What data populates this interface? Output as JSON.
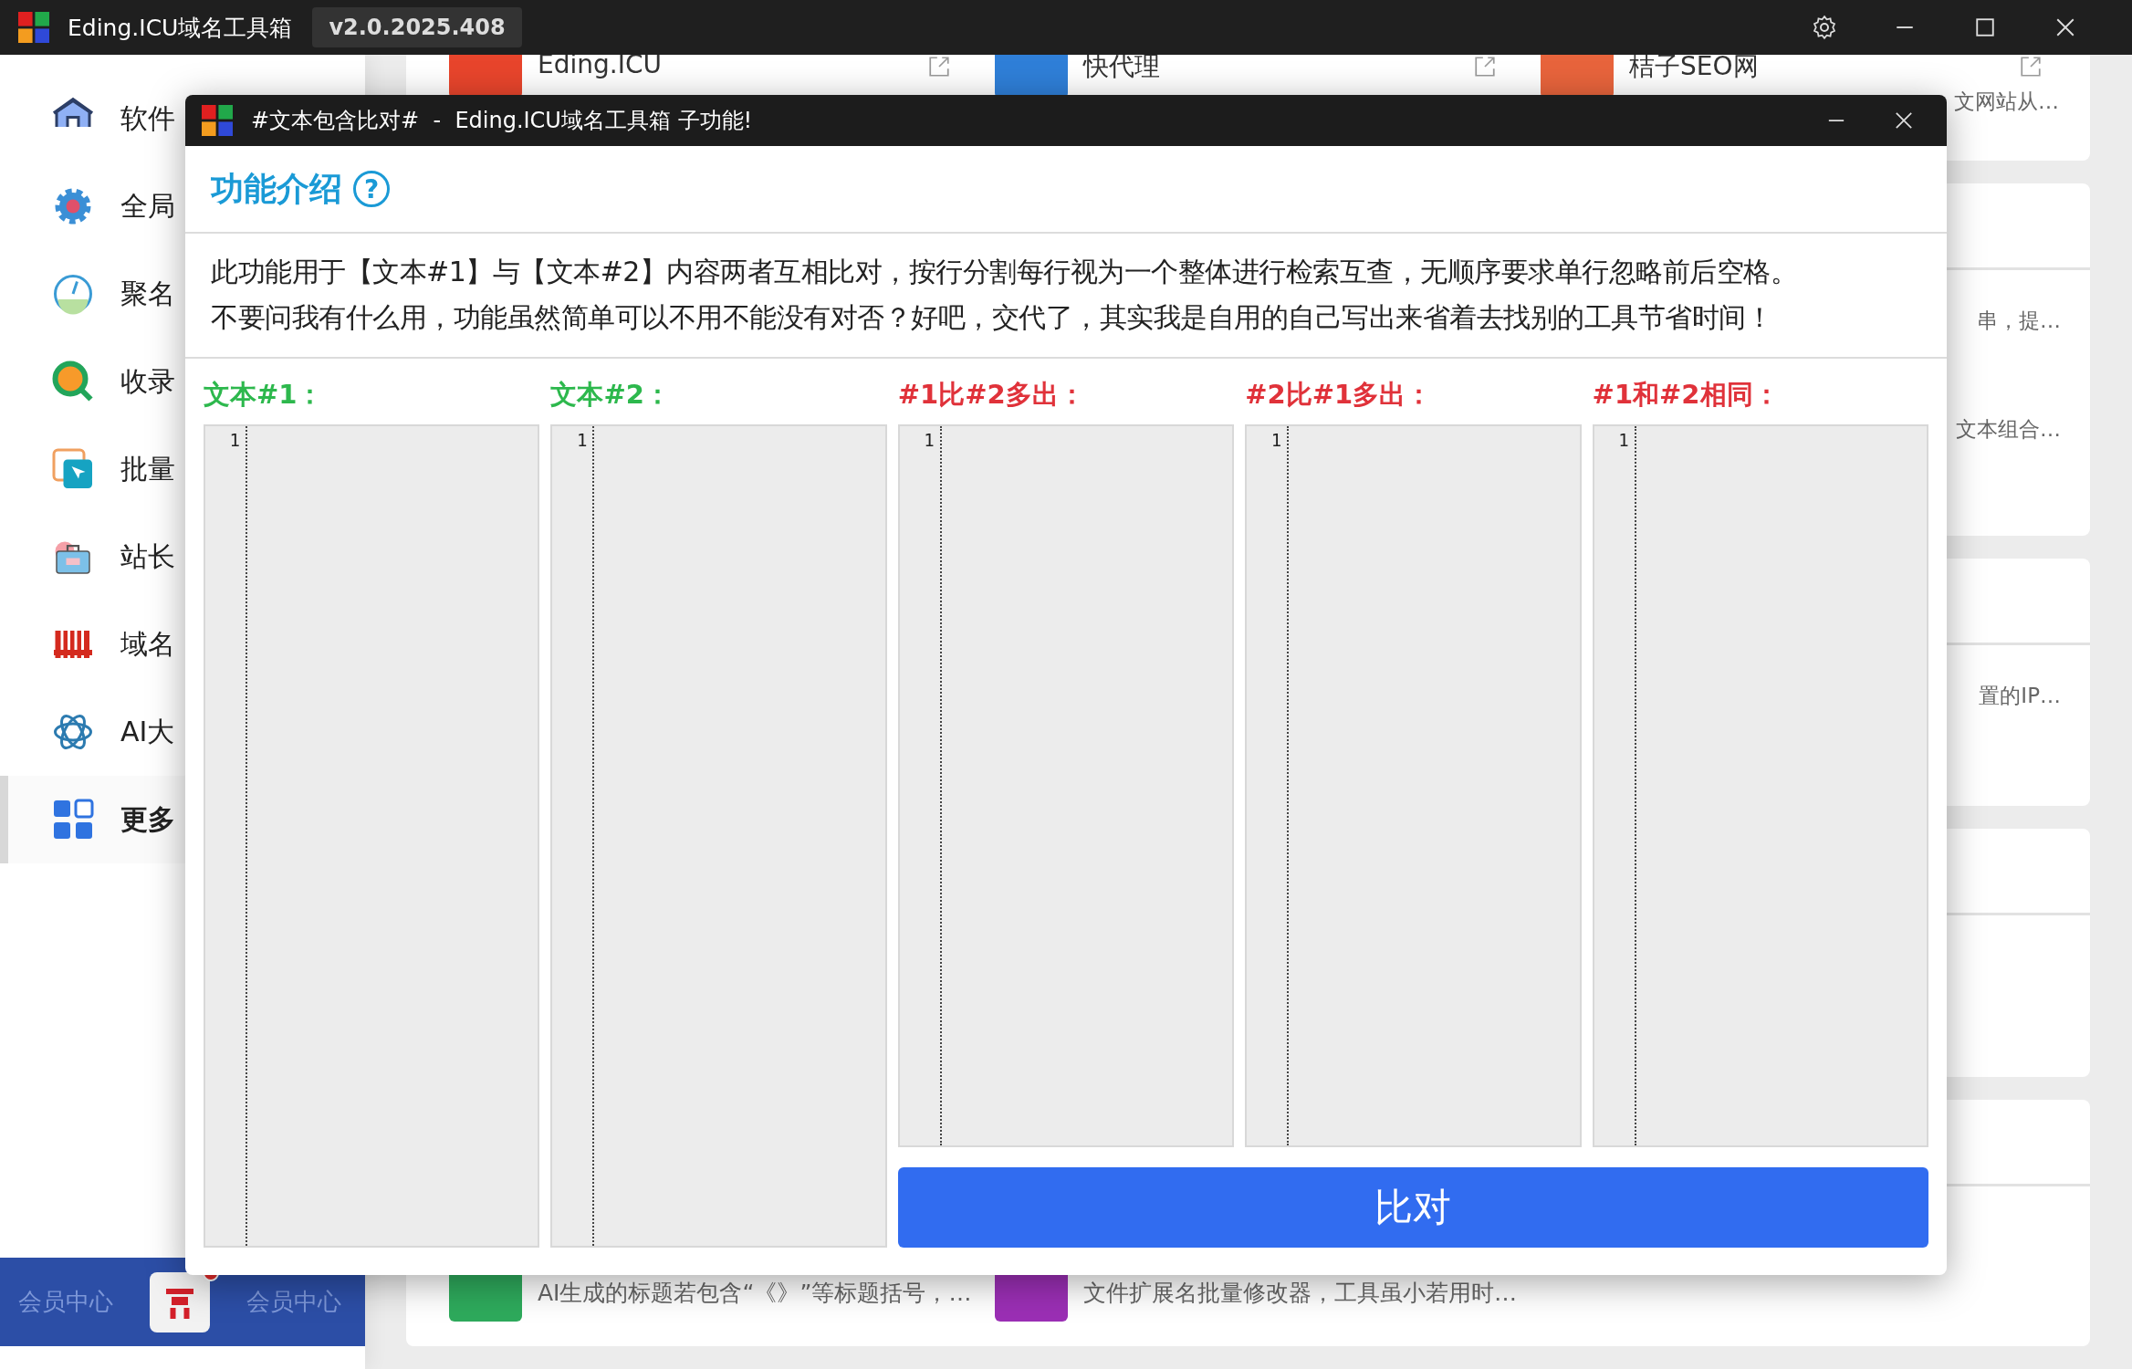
{
  "app": {
    "title": "Eding.ICU域名工具箱",
    "version": "v2.0.2025.408"
  },
  "sidebar": {
    "items": [
      {
        "label": "软件",
        "selected": false
      },
      {
        "label": "全局",
        "selected": false
      },
      {
        "label": "聚名",
        "selected": false
      },
      {
        "label": "收录",
        "selected": false
      },
      {
        "label": "批量",
        "selected": false
      },
      {
        "label": "站长",
        "selected": false
      },
      {
        "label": "域名",
        "selected": false
      },
      {
        "label": "AI大",
        "selected": false
      },
      {
        "label": "更多",
        "selected": true
      }
    ],
    "member_banner": {
      "pattern": [
        "会员中心",
        "会员中心"
      ]
    }
  },
  "content": {
    "cards": [
      {
        "kind": "grid",
        "items": [
          {
            "title": "Eding.ICU",
            "color": "#e8452c"
          },
          {
            "title": "快代理",
            "color": "#2f7fd8"
          },
          {
            "title": "桔子SEO网",
            "color": "#e8643c",
            "description": "文网站从…"
          }
        ]
      },
      {
        "kind": "tail",
        "items": [
          {
            "description": "串，提…"
          },
          {
            "description": "文本组合…"
          }
        ]
      },
      {
        "kind": "tail",
        "items": [
          {
            "description": "置的IP…"
          }
        ]
      },
      {
        "kind": "tail"
      },
      {
        "kind": "grid",
        "items": [
          {
            "color": "#2eaa5c",
            "description": "AI生成的标题若包含“《》”等标题括号，…"
          },
          {
            "color": "#9b2fb5",
            "description": "文件扩展名批量修改器，工具虽小若用时…"
          }
        ]
      }
    ]
  },
  "dialog": {
    "title": "#文本包含比对#  -  Eding.ICU域名工具箱 子功能!",
    "heading": "功能介绍",
    "help": "?",
    "description": [
      "此功能用于【文本#1】与【文本#2】内容两者互相比对，按行分割每行视为一个整体进行检索互查，无顺序要求单行忽略前后空格。",
      "不要问我有什么用，功能虽然简单可以不用不能没有对否？好吧，交代了，其实我是自用的自己写出来省着去找别的工具节省时间！"
    ],
    "columns": [
      {
        "label": "文本#1：",
        "color": "#2db84d",
        "kind": "input",
        "line_numbers": [
          "1"
        ]
      },
      {
        "label": "文本#2：",
        "color": "#2db84d",
        "kind": "input",
        "line_numbers": [
          "1"
        ]
      },
      {
        "label": "#1比#2多出：",
        "color": "#e0323a",
        "kind": "output",
        "line_numbers": [
          "1"
        ]
      },
      {
        "label": "#2比#1多出：",
        "color": "#e0323a",
        "kind": "output",
        "line_numbers": [
          "1"
        ]
      },
      {
        "label": "#1和#2相同：",
        "color": "#e0323a",
        "kind": "output",
        "line_numbers": [
          "1"
        ]
      }
    ],
    "button": "比对"
  }
}
